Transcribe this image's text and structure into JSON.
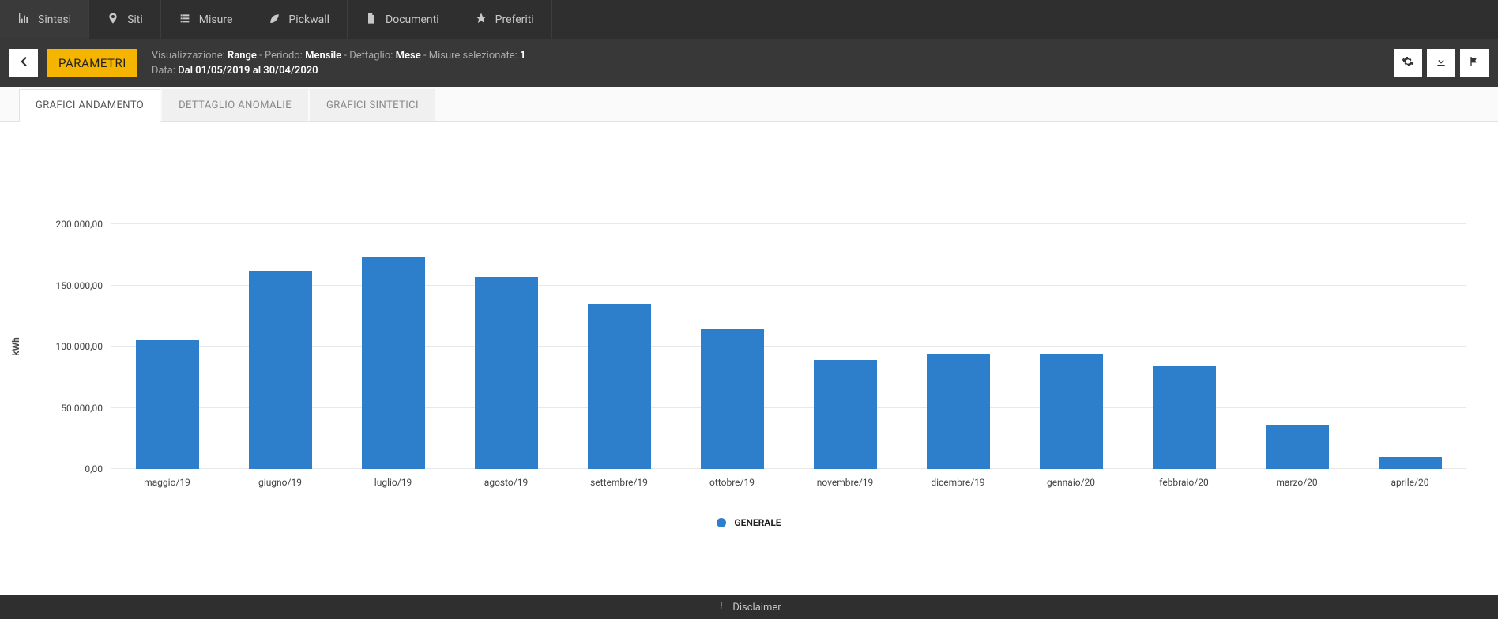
{
  "nav": {
    "items": [
      {
        "icon": "bar-chart-icon",
        "label": "Sintesi"
      },
      {
        "icon": "map-pin-icon",
        "label": "Siti"
      },
      {
        "icon": "list-icon",
        "label": "Misure"
      },
      {
        "icon": "leaf-icon",
        "label": "Pickwall"
      },
      {
        "icon": "document-icon",
        "label": "Documenti"
      },
      {
        "icon": "star-icon",
        "label": "Preferiti"
      }
    ]
  },
  "subbar": {
    "parametri": "PARAMETRI",
    "line1": {
      "visualizzazione_label": "Visualizzazione:",
      "visualizzazione_value": "Range",
      "periodo_label": "Periodo:",
      "periodo_value": "Mensile",
      "dettaglio_label": "Dettaglio:",
      "dettaglio_value": "Mese",
      "misure_label": "Misure selezionate:",
      "misure_value": "1"
    },
    "line2": {
      "data_label": "Data:",
      "data_value": "Dal 01/05/2019 al 30/04/2020"
    }
  },
  "tabs": {
    "t0": "GRAFICI ANDAMENTO",
    "t1": "DETTAGLIO ANOMALIE",
    "t2": "GRAFICI SINTETICI"
  },
  "chart_data": {
    "type": "bar",
    "ylabel": "kWh",
    "ylim": [
      0,
      200000
    ],
    "y_ticks": [
      "0,00",
      "50.000,00",
      "100.000,00",
      "150.000,00",
      "200.000,00"
    ],
    "categories": [
      "maggio/19",
      "giugno/19",
      "luglio/19",
      "agosto/19",
      "settembre/19",
      "ottobre/19",
      "novembre/19",
      "dicembre/19",
      "gennaio/20",
      "febbraio/20",
      "marzo/20",
      "aprile/20"
    ],
    "values": [
      105000,
      162000,
      173000,
      157000,
      135000,
      114000,
      89000,
      94000,
      94000,
      84000,
      36000,
      10000
    ],
    "legend": "GENERALE",
    "title": "",
    "xlabel": ""
  },
  "footer": {
    "disclaimer": "Disclaimer"
  }
}
